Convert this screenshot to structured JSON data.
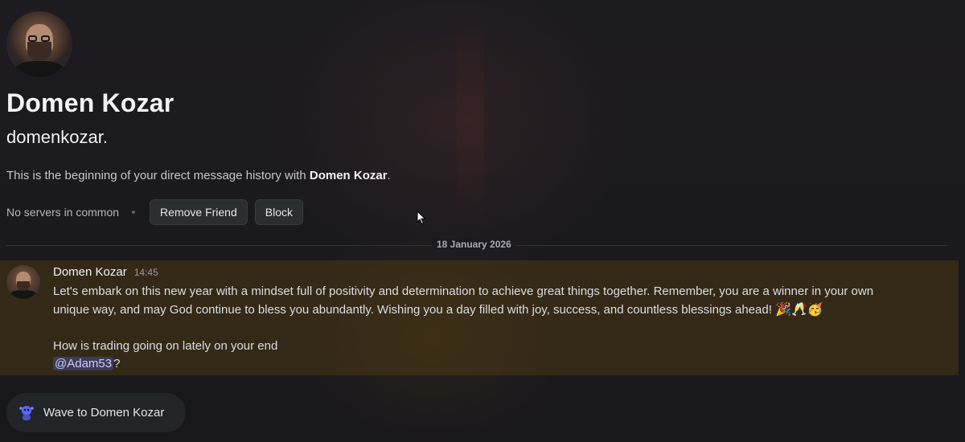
{
  "profile": {
    "display_name": "Domen Kozar",
    "username": "domenkozar.",
    "intro_prefix": "This is the beginning of your direct message history with ",
    "intro_name": "Domen Kozar",
    "intro_suffix": ".",
    "no_servers": "No servers in common",
    "remove_friend": "Remove Friend",
    "block": "Block"
  },
  "divider": {
    "date": "18 January 2026"
  },
  "message": {
    "author": "Domen Kozar",
    "time": "14:45",
    "line1": "Let's embark on this new year  with a mindset full of positivity and determination to achieve great things together. Remember, you are a winner in your own",
    "line2": "unique way, and may God continue to bless you abundantly. Wishing you a day filled with joy, success, and countless blessings ahead! ",
    "emojis": "🎉🥂🥳",
    "line3": " How is trading going on lately on your end",
    "mention": "@Adam53",
    "after_mention": "?"
  },
  "wave": {
    "label": "Wave to Domen Kozar"
  },
  "colors": {
    "background": "#1a1a1e",
    "highlight": "#543f12",
    "mention": "#5865f2",
    "button": "#2b2d31"
  }
}
